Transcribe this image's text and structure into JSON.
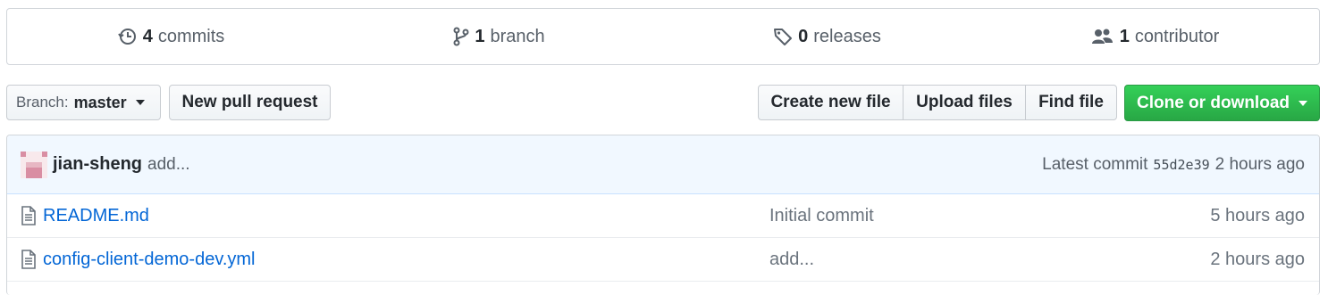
{
  "summary": {
    "commits": {
      "count": "4",
      "label": "commits",
      "icon": "history-icon"
    },
    "branches": {
      "count": "1",
      "label": "branch",
      "icon": "git-branch-icon"
    },
    "releases": {
      "count": "0",
      "label": "releases",
      "icon": "tag-icon"
    },
    "contributors": {
      "count": "1",
      "label": "contributor",
      "icon": "people-icon"
    }
  },
  "toolbar": {
    "branch_label": "Branch:",
    "branch_value": "master",
    "new_pull_request": "New pull request",
    "create_new_file": "Create new file",
    "upload_files": "Upload files",
    "find_file": "Find file",
    "clone_or_download": "Clone or download"
  },
  "latest_commit": {
    "author": "jian-sheng",
    "message": "add...",
    "label": "Latest commit",
    "sha": "55d2e39",
    "age": "2 hours ago"
  },
  "files": [
    {
      "name": "README.md",
      "message": "Initial commit",
      "age": "5 hours ago"
    },
    {
      "name": "config-client-demo-dev.yml",
      "message": "add...",
      "age": "2 hours ago"
    }
  ],
  "colors": {
    "link": "#0366d6",
    "clone_button": "#28a745",
    "commit_tease_bg": "#f1f8ff"
  }
}
